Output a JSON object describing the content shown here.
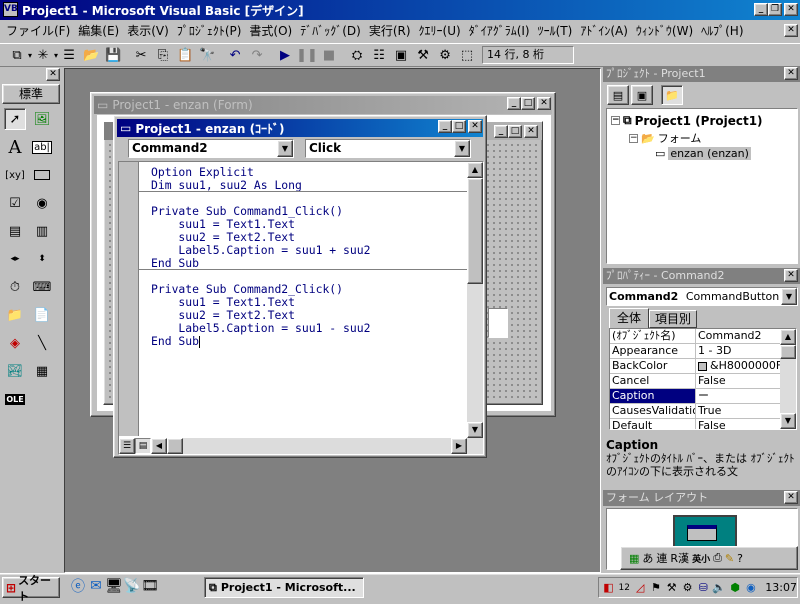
{
  "app": {
    "title": "Project1 - Microsoft Visual Basic [デザイン]",
    "controls": {
      "minimize": "_",
      "restore": "❐",
      "close": "✕"
    }
  },
  "menu": [
    "ファイル(F)",
    "編集(E)",
    "表示(V)",
    "ﾌﾟﾛｼﾞｪｸﾄ(P)",
    "書式(O)",
    "ﾃﾞﾊﾞｯｸﾞ(D)",
    "実行(R)",
    "ｸｴﾘｰ(U)",
    "ﾀﾞｲｱｸﾞﾗﾑ(I)",
    "ﾂｰﾙ(T)",
    "ｱﾄﾞｲﾝ(A)",
    "ｳｨﾝﾄﾞｳ(W)",
    "ﾍﾙﾌﾟ(H)"
  ],
  "toolbar": {
    "position": "14 行, 8 桁"
  },
  "toolbox": {
    "title": "標準"
  },
  "form_window": {
    "title": "Project1 - enzan (Form)"
  },
  "code_window": {
    "title": "Project1 - enzan (ｺｰﾄﾞ)",
    "object": "Command2",
    "procedure": "Click",
    "lines": [
      {
        "kw": "Option Explicit",
        "rest": ""
      },
      {
        "kw": "Dim",
        "rest": " suu1, suu2 As Long"
      },
      {
        "sep": true
      },
      {
        "kw": "Private Sub",
        "rest": " Command1_Click()"
      },
      {
        "kw": "",
        "rest": "    suu1 = Text1.Text"
      },
      {
        "kw": "",
        "rest": "    suu2 = Text2.Text"
      },
      {
        "kw": "",
        "rest": "    Label5.Caption = suu1 + suu2"
      },
      {
        "kw": "End Sub",
        "rest": ""
      },
      {
        "sep": true
      },
      {
        "kw": "Private Sub",
        "rest": " Command2_Click()"
      },
      {
        "kw": "",
        "rest": "    suu1 = Text1.Text"
      },
      {
        "kw": "",
        "rest": "    suu2 = Text2.Text"
      },
      {
        "kw": "",
        "rest": "    Label5.Caption = suu1 - suu2"
      },
      {
        "kw": "End Sub",
        "rest": ""
      }
    ]
  },
  "project_panel": {
    "title": "ﾌﾟﾛｼﾞｪｸﾄ - Project1",
    "root": "Project1 (Project1)",
    "folder": "フォーム",
    "item": "enzan (enzan)"
  },
  "properties_panel": {
    "title": "ﾌﾟﾛﾊﾟﾃｨｰ - Command2",
    "object_name": "Command2",
    "object_type": "CommandButton",
    "tabs": [
      "全体",
      "項目別"
    ],
    "rows": [
      {
        "name": "(ｵﾌﾞｼﾞｪｸﾄ名)",
        "value": "Command2"
      },
      {
        "name": "Appearance",
        "value": "1 - 3D"
      },
      {
        "name": "BackColor",
        "value": "&H8000000F"
      },
      {
        "name": "Cancel",
        "value": "False"
      },
      {
        "name": "Caption",
        "value": "ー"
      },
      {
        "name": "CausesValidation",
        "value": "True"
      },
      {
        "name": "Default",
        "value": "False"
      }
    ],
    "desc_title": "Caption",
    "desc_text": "ｵﾌﾞｼﾞｪｸﾄのﾀｲﾄﾙ ﾊﾞｰ、または ｵﾌﾞｼﾞｪｸﾄのｱｲｺﾝの下に表示される文"
  },
  "layout_panel": {
    "title": "フォーム レイアウト"
  },
  "ime": [
    "あ",
    "連",
    "R漢",
    "英小"
  ],
  "taskbar": {
    "start": "スタート",
    "task": "Project1 - Microsoft...",
    "clock": "13:07"
  }
}
